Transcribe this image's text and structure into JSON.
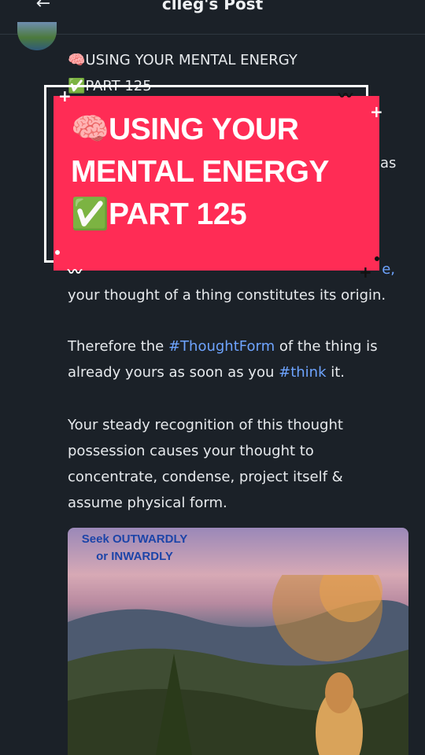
{
  "header": {
    "back_icon": "arrow-left-icon",
    "back_glyph": "←",
    "title": "clleg's Post"
  },
  "post": {
    "heading_line1": "🧠USING YOUR MENTAL ENERGY",
    "heading_line2": "✅PART 125",
    "partial_right_word": "as",
    "paragraph1_end": "e,",
    "paragraph1_line2": "your thought of a thing constitutes its origin.",
    "paragraph2_pre": "Therefore the ",
    "paragraph2_tag1": "#ThoughtForm",
    "paragraph2_mid": " of the thing is already yours as soon as you ",
    "paragraph2_tag2": "#think",
    "paragraph2_end": " it.",
    "paragraph3": "Your steady recognition of this thought possession causes your thought to concentrate, condense, project itself & assume physical form."
  },
  "banner": {
    "line1": "🧠USING YOUR",
    "line2": "MENTAL ENERGY",
    "line3": "✅PART 125",
    "background": "#ff2c55"
  },
  "image": {
    "caption_line1": "Seek OUTWARDLY",
    "caption_line2": "or INWARDLY"
  },
  "colors": {
    "background": "#1b2128",
    "text": "#e7eaed",
    "hashtag": "#6ea4ff"
  }
}
